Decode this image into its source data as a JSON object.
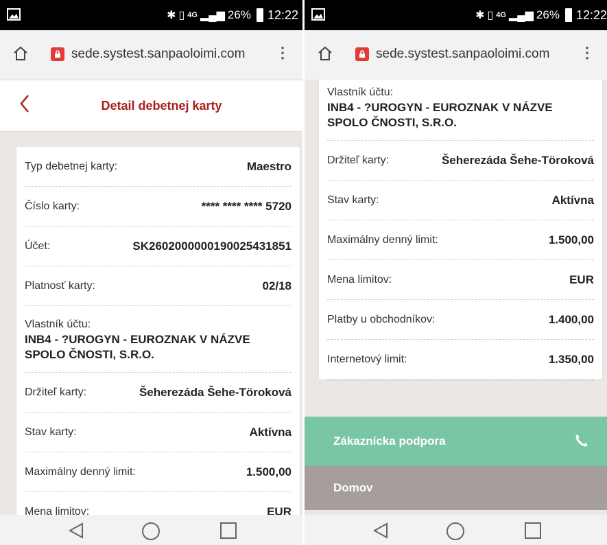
{
  "status": {
    "battery": "26%",
    "time": "12:22",
    "network": "4G"
  },
  "browser": {
    "url": "sede.systest.sanpaoloimi.com"
  },
  "header": {
    "title": "Detail debetnej karty"
  },
  "fields": [
    {
      "label": "Typ debetnej karty:",
      "value": "Maestro"
    },
    {
      "label": "Číslo karty:",
      "value": "**** **** **** 5720"
    },
    {
      "label": "Účet:",
      "value": "SK2602000000190025431851"
    },
    {
      "label": "Platnosť karty:",
      "value": "02/18"
    },
    {
      "label": "Vlastník účtu:",
      "value": "INB4 - ?UROGYN - EUROZNAK V NÁZVE SPOLO ČNOSTI, S.R.O."
    },
    {
      "label": "Držiteľ karty:",
      "value": "Šeherezáda Šehe-Töroková"
    },
    {
      "label": "Stav karty:",
      "value": "Aktívna"
    },
    {
      "label": "Maximálny denný limit:",
      "value": "1.500,00"
    },
    {
      "label": "Mena limitov:",
      "value": "EUR"
    },
    {
      "label": "Platby u obchodníkov:",
      "value": "1.400,00"
    },
    {
      "label": "Internetový limit:",
      "value": "1.350,00"
    }
  ],
  "footer": {
    "support_label": "Zákaznícka podpora",
    "home_label": "Domov"
  },
  "colors": {
    "accent": "#a8201a",
    "support": "#79c6a4",
    "home": "#a59e9c"
  }
}
